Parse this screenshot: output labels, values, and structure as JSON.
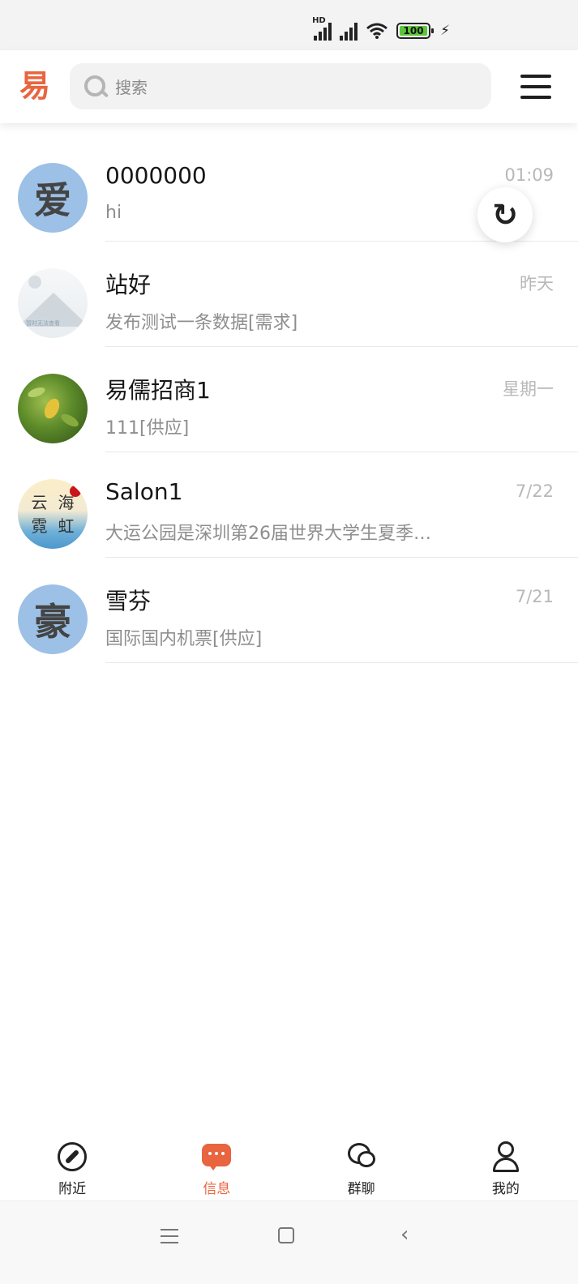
{
  "status_bar": {
    "hd_label": "HD",
    "battery_level": "100",
    "charging_icon": "bolt-icon"
  },
  "header": {
    "logo_text": "易",
    "search_placeholder": "搜索",
    "search_icon": "search-icon",
    "menu_icon": "hamburger-menu-icon"
  },
  "conversations": [
    {
      "name": "0000000",
      "preview": "hi",
      "time": "01:09",
      "avatar_char": "爱"
    },
    {
      "name": "站好",
      "preview": "发布测试一条数据[需求]",
      "time": "昨天",
      "avatar_caption": "暂时无法查看"
    },
    {
      "name": "易儒招商1",
      "preview": "111[供应]",
      "time": "星期一"
    },
    {
      "name": "Salon1",
      "preview": "大运公园是深圳第26届世界大学生夏季…",
      "time": "7/22",
      "avatar_chars": [
        "云",
        "海",
        "霓",
        "虹"
      ]
    },
    {
      "name": "雪芬",
      "preview": "国际国内机票[供应]",
      "time": "7/21",
      "avatar_char": "豪"
    }
  ],
  "sync_button_icon": "refresh-icon",
  "tabs": [
    {
      "label": "附近",
      "icon": "compass-icon",
      "active": false
    },
    {
      "label": "信息",
      "icon": "message-icon",
      "active": true
    },
    {
      "label": "群聊",
      "icon": "group-chat-icon",
      "active": false
    },
    {
      "label": "我的",
      "icon": "user-icon",
      "active": false
    }
  ],
  "colors": {
    "accent": "#e8653f",
    "avatar_blue": "#9cc0e6",
    "muted_text": "#8e8e8e"
  }
}
